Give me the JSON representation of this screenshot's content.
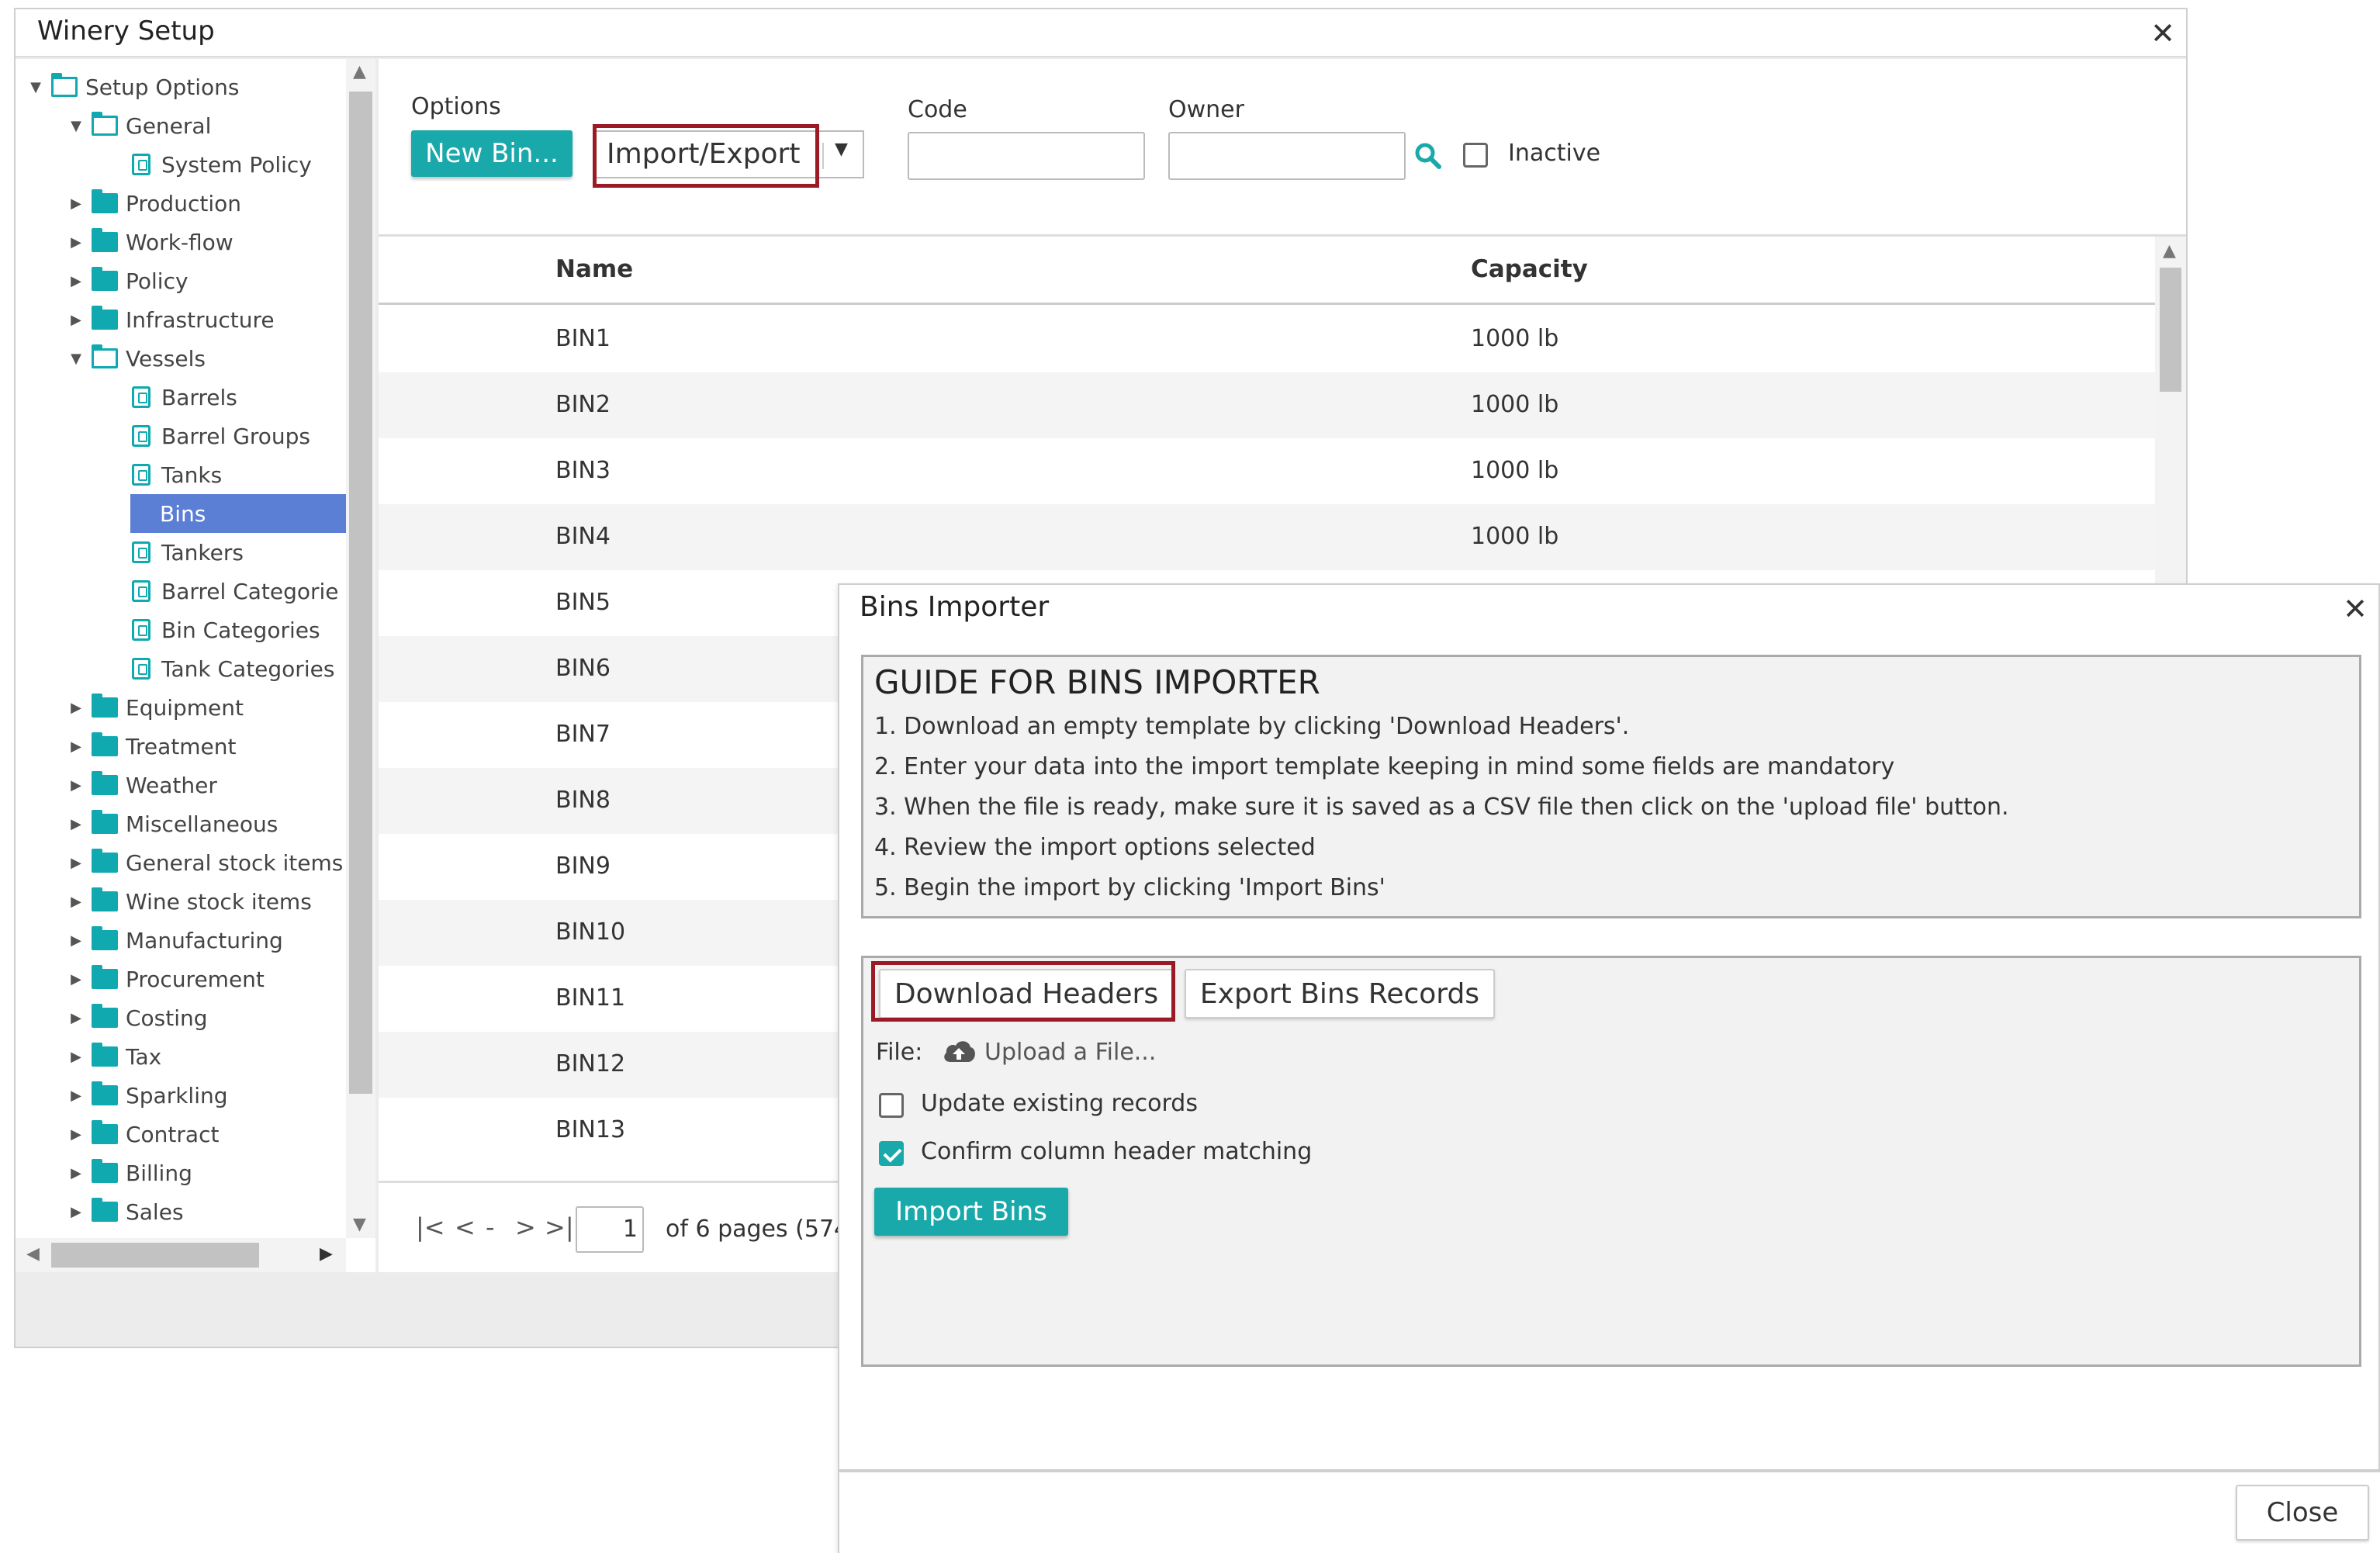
{
  "main_window": {
    "title": "Winery Setup",
    "close_glyph": "✕"
  },
  "tree": {
    "items": [
      {
        "label": "Setup Options",
        "level": 0,
        "kind": "folder-open",
        "expander": "expanded"
      },
      {
        "label": "General",
        "level": 1,
        "kind": "folder-open",
        "expander": "expanded"
      },
      {
        "label": "System Policy",
        "level": 2,
        "kind": "leaf",
        "expander": "none"
      },
      {
        "label": "Production",
        "level": 1,
        "kind": "folder",
        "expander": "collapsed"
      },
      {
        "label": "Work-flow",
        "level": 1,
        "kind": "folder",
        "expander": "collapsed"
      },
      {
        "label": "Policy",
        "level": 1,
        "kind": "folder",
        "expander": "collapsed"
      },
      {
        "label": "Infrastructure",
        "level": 1,
        "kind": "folder",
        "expander": "collapsed"
      },
      {
        "label": "Vessels",
        "level": 1,
        "kind": "folder-open",
        "expander": "expanded"
      },
      {
        "label": "Barrels",
        "level": 2,
        "kind": "leaf",
        "expander": "none"
      },
      {
        "label": "Barrel Groups",
        "level": 2,
        "kind": "leaf",
        "expander": "none"
      },
      {
        "label": "Tanks",
        "level": 2,
        "kind": "leaf",
        "expander": "none"
      },
      {
        "label": "Bins",
        "level": 2,
        "kind": "leaf",
        "expander": "none",
        "selected": true
      },
      {
        "label": "Tankers",
        "level": 2,
        "kind": "leaf",
        "expander": "none"
      },
      {
        "label": "Barrel Categorie",
        "level": 2,
        "kind": "leaf",
        "expander": "none"
      },
      {
        "label": "Bin Categories",
        "level": 2,
        "kind": "leaf",
        "expander": "none"
      },
      {
        "label": "Tank Categories",
        "level": 2,
        "kind": "leaf",
        "expander": "none"
      },
      {
        "label": "Equipment",
        "level": 1,
        "kind": "folder",
        "expander": "collapsed"
      },
      {
        "label": "Treatment",
        "level": 1,
        "kind": "folder",
        "expander": "collapsed"
      },
      {
        "label": "Weather",
        "level": 1,
        "kind": "folder",
        "expander": "collapsed"
      },
      {
        "label": "Miscellaneous",
        "level": 1,
        "kind": "folder",
        "expander": "collapsed"
      },
      {
        "label": "General stock items",
        "level": 1,
        "kind": "folder",
        "expander": "collapsed"
      },
      {
        "label": "Wine stock items",
        "level": 1,
        "kind": "folder",
        "expander": "collapsed"
      },
      {
        "label": "Manufacturing",
        "level": 1,
        "kind": "folder",
        "expander": "collapsed"
      },
      {
        "label": "Procurement",
        "level": 1,
        "kind": "folder",
        "expander": "collapsed"
      },
      {
        "label": "Costing",
        "level": 1,
        "kind": "folder",
        "expander": "collapsed"
      },
      {
        "label": "Tax",
        "level": 1,
        "kind": "folder",
        "expander": "collapsed"
      },
      {
        "label": "Sparkling",
        "level": 1,
        "kind": "folder",
        "expander": "collapsed"
      },
      {
        "label": "Contract",
        "level": 1,
        "kind": "folder",
        "expander": "collapsed"
      },
      {
        "label": "Billing",
        "level": 1,
        "kind": "folder",
        "expander": "collapsed"
      },
      {
        "label": "Sales",
        "level": 1,
        "kind": "folder",
        "expander": "collapsed"
      }
    ]
  },
  "toolbar": {
    "options_label": "Options",
    "new_bin_label": "New Bin...",
    "import_export_value": "Import/Export",
    "code_label": "Code",
    "code_value": "",
    "owner_label": "Owner",
    "owner_value": "",
    "inactive_label": "Inactive",
    "inactive_checked": false
  },
  "grid": {
    "columns": [
      "Name",
      "Capacity"
    ],
    "rows": [
      [
        "BIN1",
        "1000 lb"
      ],
      [
        "BIN2",
        "1000 lb"
      ],
      [
        "BIN3",
        "1000 lb"
      ],
      [
        "BIN4",
        "1000 lb"
      ],
      [
        "BIN5",
        ""
      ],
      [
        "BIN6",
        ""
      ],
      [
        "BIN7",
        ""
      ],
      [
        "BIN8",
        ""
      ],
      [
        "BIN9",
        ""
      ],
      [
        "BIN10",
        ""
      ],
      [
        "BIN11",
        ""
      ],
      [
        "BIN12",
        ""
      ],
      [
        "BIN13",
        ""
      ]
    ]
  },
  "pager": {
    "first_glyph": "|<",
    "prev_glyph": "<",
    "dash": "-",
    "next_glyph": ">",
    "last_glyph": ">|",
    "page_value": "1",
    "page_text": "of 6 pages (574"
  },
  "importer": {
    "title": "Bins Importer",
    "close_glyph": "✕",
    "guide_title": "GUIDE FOR BINS IMPORTER",
    "guide_lines": [
      "1. Download an empty template by clicking 'Download Headers'.",
      "2. Enter your data into the import template keeping in mind some fields are mandatory",
      "3. When the file is ready, make sure it is saved as a CSV file then click on the 'upload file' button.",
      "4. Review the import options selected",
      "5. Begin the import by clicking 'Import Bins'"
    ],
    "download_headers_label": "Download Headers",
    "export_records_label": "Export Bins Records",
    "file_label": "File:",
    "upload_label": "Upload a File...",
    "update_existing_label": "Update existing records",
    "update_existing_checked": false,
    "confirm_header_label": "Confirm column header matching",
    "confirm_header_checked": true,
    "import_button_label": "Import Bins",
    "close_button_label": "Close"
  },
  "colors": {
    "accent": "#1aa9aa",
    "highlight_frame": "#9a1a26",
    "tree_selected": "#5b7fd4",
    "folder": "#10a9b0"
  }
}
